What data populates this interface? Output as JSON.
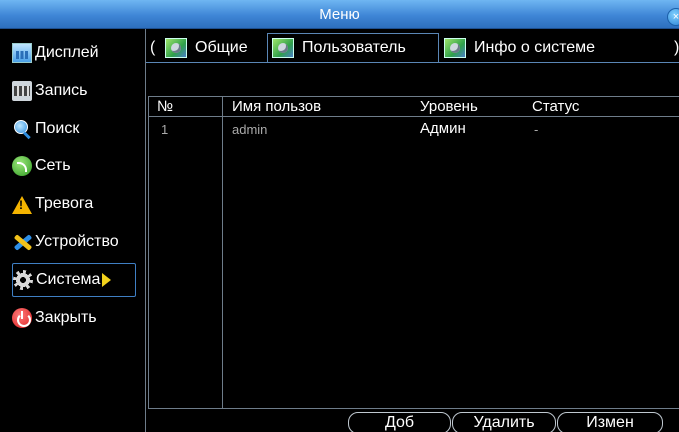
{
  "window": {
    "title": "Меню",
    "close_label": "×"
  },
  "sidebar": {
    "items": [
      {
        "label": "Дисплей",
        "icon": "display-icon"
      },
      {
        "label": "Запись",
        "icon": "record-icon"
      },
      {
        "label": "Поиск",
        "icon": "search-icon"
      },
      {
        "label": "Сеть",
        "icon": "network-icon"
      },
      {
        "label": "Тревога",
        "icon": "alarm-icon"
      },
      {
        "label": "Устройство",
        "icon": "device-icon"
      },
      {
        "label": "Система",
        "icon": "system-icon",
        "active": true
      },
      {
        "label": "Закрыть",
        "icon": "power-icon"
      }
    ]
  },
  "tabs": {
    "prev": "(",
    "next": ")",
    "items": [
      {
        "label": "Общие"
      },
      {
        "label": "Пользователь",
        "active": true
      },
      {
        "label": "Инфо о системе"
      }
    ]
  },
  "users_table": {
    "columns": [
      "№",
      "Имя пользов",
      "Уровень",
      "Статус"
    ],
    "rows": [
      {
        "num": "1",
        "name": "admin",
        "level": "Админ",
        "status": "-"
      }
    ]
  },
  "buttons": {
    "add": "Доб",
    "delete": "Удалить",
    "edit": "Измен"
  },
  "colors": {
    "titlebar": "#3f86d6",
    "active_arrow": "#f2d21c",
    "border": "#6e7c8a"
  }
}
